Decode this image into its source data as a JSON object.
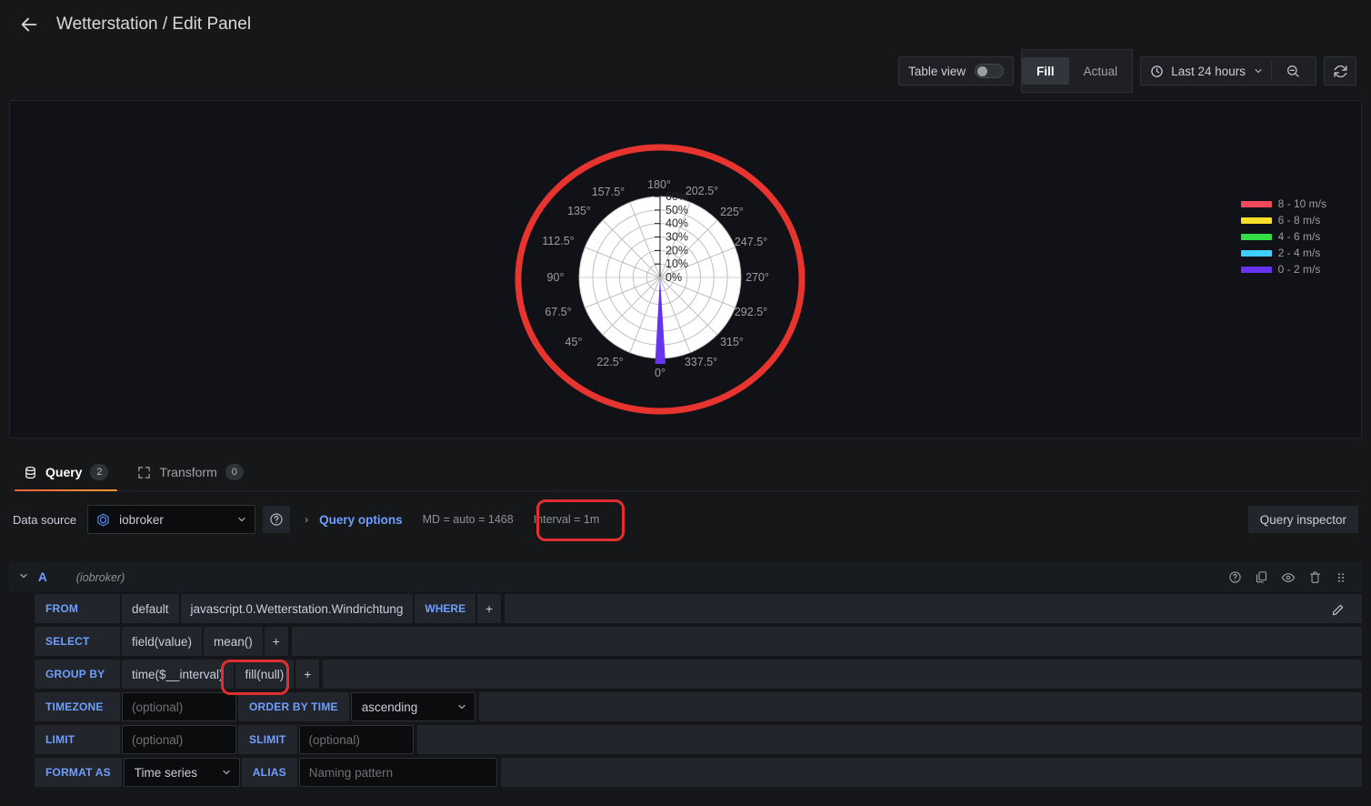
{
  "header": {
    "back_icon": "arrow-left-icon",
    "title": "Wetterstation / Edit Panel"
  },
  "toolbar": {
    "table_view_label": "Table view",
    "table_view_on": false,
    "fill_label": "Fill",
    "actual_label": "Actual",
    "active_segment": "Fill",
    "clock_icon": "clock-icon",
    "time_range": "Last 24 hours",
    "chevron_icon": "chevron-down-icon",
    "zoom_out_icon": "zoom-out-icon",
    "refresh_icon": "refresh-icon"
  },
  "panel": {
    "legend": [
      {
        "label": "8 - 10 m/s",
        "color": "#f2495c"
      },
      {
        "label": "6 - 8 m/s",
        "color": "#fade2a"
      },
      {
        "label": "4 - 6 m/s",
        "color": "#33dd44"
      },
      {
        "label": "2 - 4 m/s",
        "color": "#3ecfff"
      },
      {
        "label": "0 - 2 m/s",
        "color": "#6633ee"
      }
    ],
    "highlight_color": "#e02f2f"
  },
  "chart_data": {
    "type": "polar",
    "title": "",
    "angle_unit": "degrees",
    "angle_labels": [
      "0°",
      "22.5°",
      "45°",
      "67.5°",
      "90°",
      "112.5°",
      "135°",
      "157.5°",
      "180°",
      "202.5°",
      "225°",
      "247.5°",
      "270°",
      "292.5°",
      "315°",
      "337.5°"
    ],
    "radial_ticks": [
      "0%",
      "10%",
      "20%",
      "30%",
      "40%",
      "50%",
      "60%"
    ],
    "rlim": [
      0,
      60
    ],
    "rlabel": "%",
    "grid": true,
    "legend_position": "right",
    "series": [
      {
        "name": "0 - 2 m/s",
        "color": "#6633ee",
        "direction_deg": 0,
        "value_pct": 62
      },
      {
        "name": "2 - 4 m/s",
        "color": "#3ecfff",
        "direction_deg": 0,
        "value_pct": 0
      },
      {
        "name": "4 - 6 m/s",
        "color": "#33dd44",
        "direction_deg": 0,
        "value_pct": 0
      },
      {
        "name": "6 - 8 m/s",
        "color": "#fade2a",
        "direction_deg": 0,
        "value_pct": 0
      },
      {
        "name": "8 - 10 m/s",
        "color": "#f2495c",
        "direction_deg": 0,
        "value_pct": 0
      }
    ]
  },
  "tabs": [
    {
      "label": "Query",
      "badge": "2",
      "icon": "database-icon",
      "active": true
    },
    {
      "label": "Transform",
      "badge": "0",
      "icon": "transform-icon",
      "active": false
    }
  ],
  "query_options": {
    "data_source_label": "Data source",
    "data_source_name": "iobroker",
    "data_source_icon": "iobroker-icon",
    "help_icon": "help-circle-icon",
    "expand_caret": "›",
    "query_options_label": "Query options",
    "max_data_points": "MD = auto = 1468",
    "interval": "Interval = 1m",
    "query_inspector_label": "Query inspector"
  },
  "query_a": {
    "ref_id": "A",
    "datasource": "(iobroker)",
    "collapse_icon": "chevron-down-icon",
    "actions": [
      {
        "name": "help-icon"
      },
      {
        "name": "duplicate-icon"
      },
      {
        "name": "eye-icon"
      },
      {
        "name": "trash-icon"
      },
      {
        "name": "drag-handle-icon"
      }
    ],
    "rows": {
      "from": {
        "key": "FROM",
        "policy": "default",
        "measurement": "javascript.0.Wetterstation.Windrichtung",
        "where": "WHERE",
        "plus": "+",
        "edit_icon": "pencil-icon"
      },
      "select": {
        "key": "SELECT",
        "field": "field(value)",
        "func": "mean()",
        "plus": "+"
      },
      "group_by": {
        "key": "GROUP BY",
        "time": "time($__interval)",
        "fill": "fill(null)",
        "plus": "+"
      },
      "timezone": {
        "key": "TIMEZONE",
        "placeholder": "(optional)",
        "order_key": "ORDER BY TIME",
        "order_value": "ascending"
      },
      "limit": {
        "key": "LIMIT",
        "placeholder": "(optional)",
        "slimit_key": "SLIMIT",
        "slimit_placeholder": "(optional)"
      },
      "format": {
        "key": "FORMAT AS",
        "value": "Time series",
        "alias_key": "ALIAS",
        "alias_placeholder": "Naming pattern"
      }
    }
  }
}
